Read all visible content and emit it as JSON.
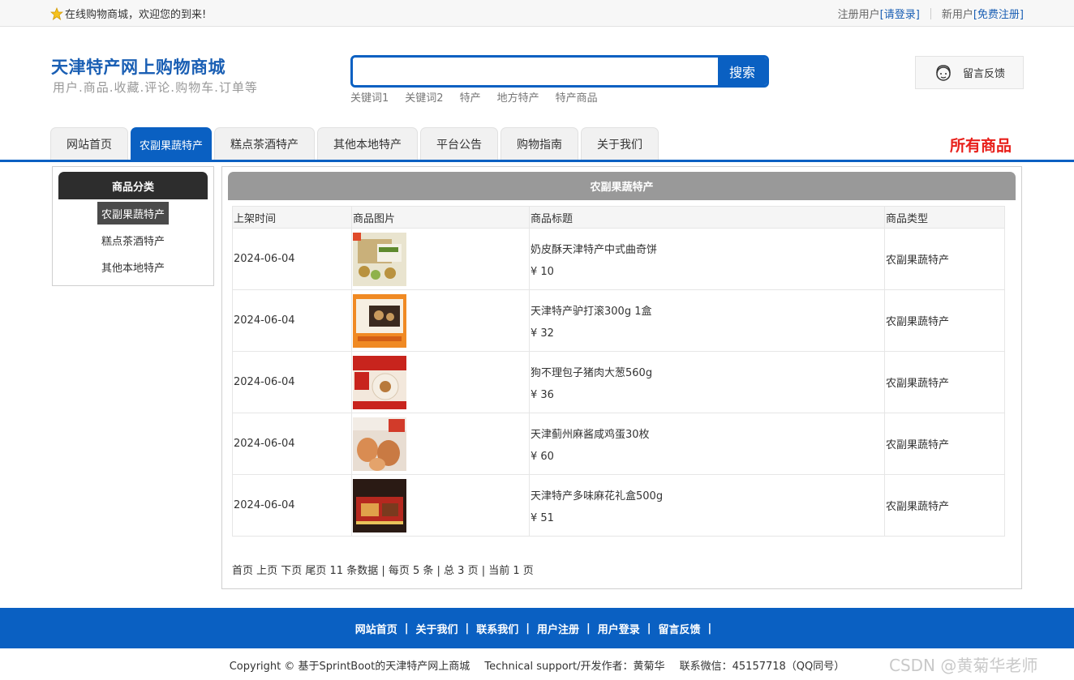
{
  "topbar": {
    "welcome": "在线购物商城，欢迎您的到来!",
    "register_label": "注册用户",
    "login_link": "[请登录]",
    "new_user_label": "新用户",
    "signup_link": "[免费注册]"
  },
  "header": {
    "site_title": "天津特产网上购物商城",
    "site_subtitle": "用户.商品.收藏.评论.购物车.订单等",
    "search_placeholder": "",
    "search_button": "搜索",
    "keywords": [
      "关键词1",
      "关键词2",
      "特产",
      "地方特产",
      "特产商品"
    ],
    "feedback": "留言反馈"
  },
  "nav": {
    "tabs": [
      "网站首页",
      "农副果蔬特产",
      "糕点茶酒特产",
      "其他本地特产",
      "平台公告",
      "购物指南",
      "关于我们"
    ],
    "active_index": 1,
    "all_goods": "所有商品"
  },
  "sidebar": {
    "title": "商品分类",
    "items": [
      "农副果蔬特产",
      "糕点茶酒特产",
      "其他本地特产"
    ]
  },
  "main": {
    "section_title": "农副果蔬特产",
    "columns": [
      "上架时间",
      "商品图片",
      "商品标题",
      "商品类型"
    ],
    "rows": [
      {
        "date": "2024-06-04",
        "title": "奶皮酥天津特产中式曲奇饼",
        "price": "¥ 10",
        "type": "农副果蔬特产"
      },
      {
        "date": "2024-06-04",
        "title": "天津特产驴打滚300g 1盒",
        "price": "¥ 32",
        "type": "农副果蔬特产"
      },
      {
        "date": "2024-06-04",
        "title": "狗不理包子猪肉大葱560g",
        "price": "¥ 36",
        "type": "农副果蔬特产"
      },
      {
        "date": "2024-06-04",
        "title": "天津蓟州麻酱咸鸡蛋30枚",
        "price": "¥ 60",
        "type": "农副果蔬特产"
      },
      {
        "date": "2024-06-04",
        "title": "天津特产多味麻花礼盒500g",
        "price": "¥ 51",
        "type": "农副果蔬特产"
      }
    ],
    "pager": "首页 上页 下页 尾页 11 条数据 | 每页 5 条 | 总 3 页 | 当前 1 页"
  },
  "footer": {
    "links": [
      "网站首页",
      "关于我们",
      "联系我们",
      "用户注册",
      "用户登录",
      "留言反馈"
    ],
    "copyright": "Copyright © 基于SprintBoot的天津特产网上商城",
    "support": "Technical support/开发作者：黄菊华",
    "contact": "联系微信：45157718（QQ同号）",
    "watermark": "CSDN @黄菊华老师"
  },
  "colors": {
    "brand_blue": "#0a60c2",
    "accent_red": "#e8201b"
  }
}
